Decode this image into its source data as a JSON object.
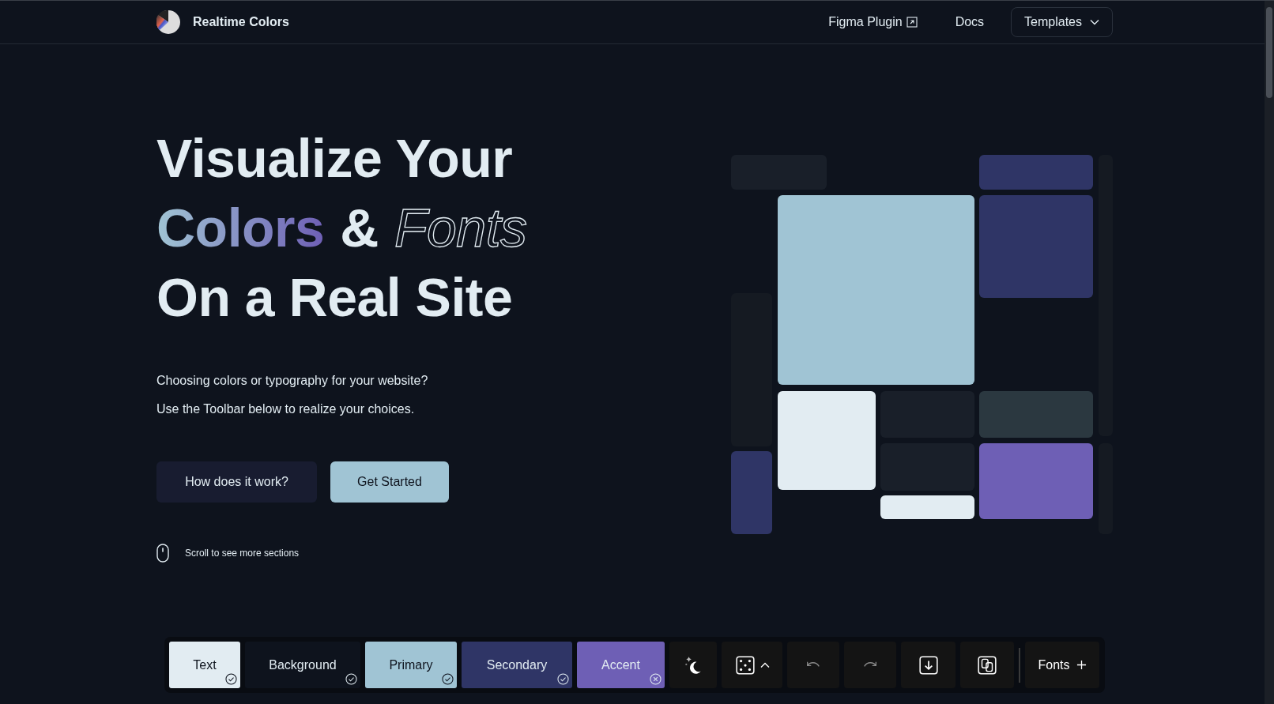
{
  "header": {
    "brand": "Realtime Colors",
    "nav": [
      {
        "label": "Figma Plugin",
        "kind": "external"
      },
      {
        "label": "Docs",
        "kind": "plain"
      },
      {
        "label": "Templates",
        "kind": "dropdown"
      }
    ]
  },
  "hero": {
    "title_lines": [
      [
        {
          "text": "Visualize Your",
          "kind": "plain"
        }
      ],
      [
        {
          "text": "Colors",
          "kind": "gradient"
        },
        {
          "text": "&",
          "kind": "plain"
        },
        {
          "text": "Fonts",
          "kind": "outline"
        }
      ],
      [
        {
          "text": "On a Real Site",
          "kind": "plain"
        }
      ]
    ],
    "paragraphs": [
      "Choosing colors or typography for your website?",
      "Use the Toolbar below to realize your choices."
    ],
    "buttons": [
      {
        "label": "How does it work?",
        "kind": "secondary"
      },
      {
        "label": "Get Started",
        "kind": "primary"
      }
    ],
    "scroll_hint": "Scroll to see more sections"
  },
  "toolbar": {
    "swatches": [
      {
        "label": "Text",
        "color": "#e2ecf2",
        "contrast_ok": true
      },
      {
        "label": "Background",
        "color": "#0e131d",
        "contrast_ok": true
      },
      {
        "label": "Primary",
        "color": "#a0c4d4",
        "contrast_ok": true
      },
      {
        "label": "Secondary",
        "color": "#2f3566",
        "contrast_ok": true
      },
      {
        "label": "Accent",
        "color": "#6e5fb5",
        "contrast_ok": false
      }
    ],
    "fonts_label": "Fonts"
  }
}
